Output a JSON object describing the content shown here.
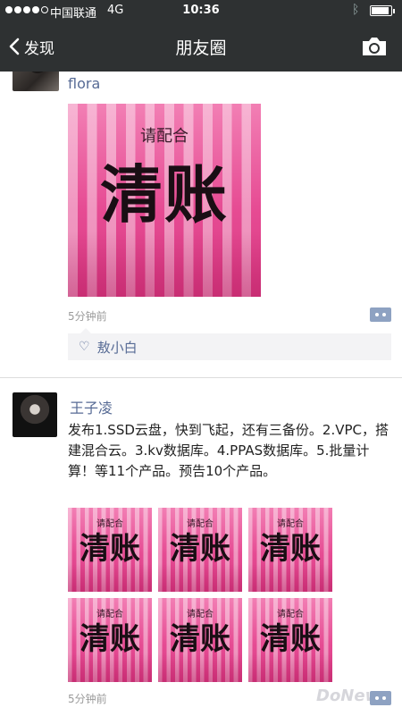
{
  "status": {
    "carrier": "中国联通",
    "network": "4G",
    "time": "10:36",
    "signal_bars": 4,
    "signal_total": 5
  },
  "nav": {
    "back_label": "发现",
    "title": "朋友圈"
  },
  "posts": [
    {
      "author": "flora",
      "image": {
        "small_text": "请配合",
        "big_text": "清账"
      },
      "time": "5分钟前",
      "likes": [
        "敖小白"
      ]
    },
    {
      "author": "王子凌",
      "text": "发布1.SSD云盘，快到飞起，还有三备份。2.VPC，搭建混合云。3.kv数据库。4.PPAS数据库。5.批量计算！等11个产品。预告10个产品。",
      "image_count": 6,
      "image": {
        "small_text": "请配合",
        "big_text": "清账"
      },
      "time": "5分钟前"
    }
  ],
  "watermark": "DoNews",
  "colors": {
    "nav_bg": "#2e3132",
    "link": "#576b95",
    "poster_pink": "#e64b93"
  }
}
